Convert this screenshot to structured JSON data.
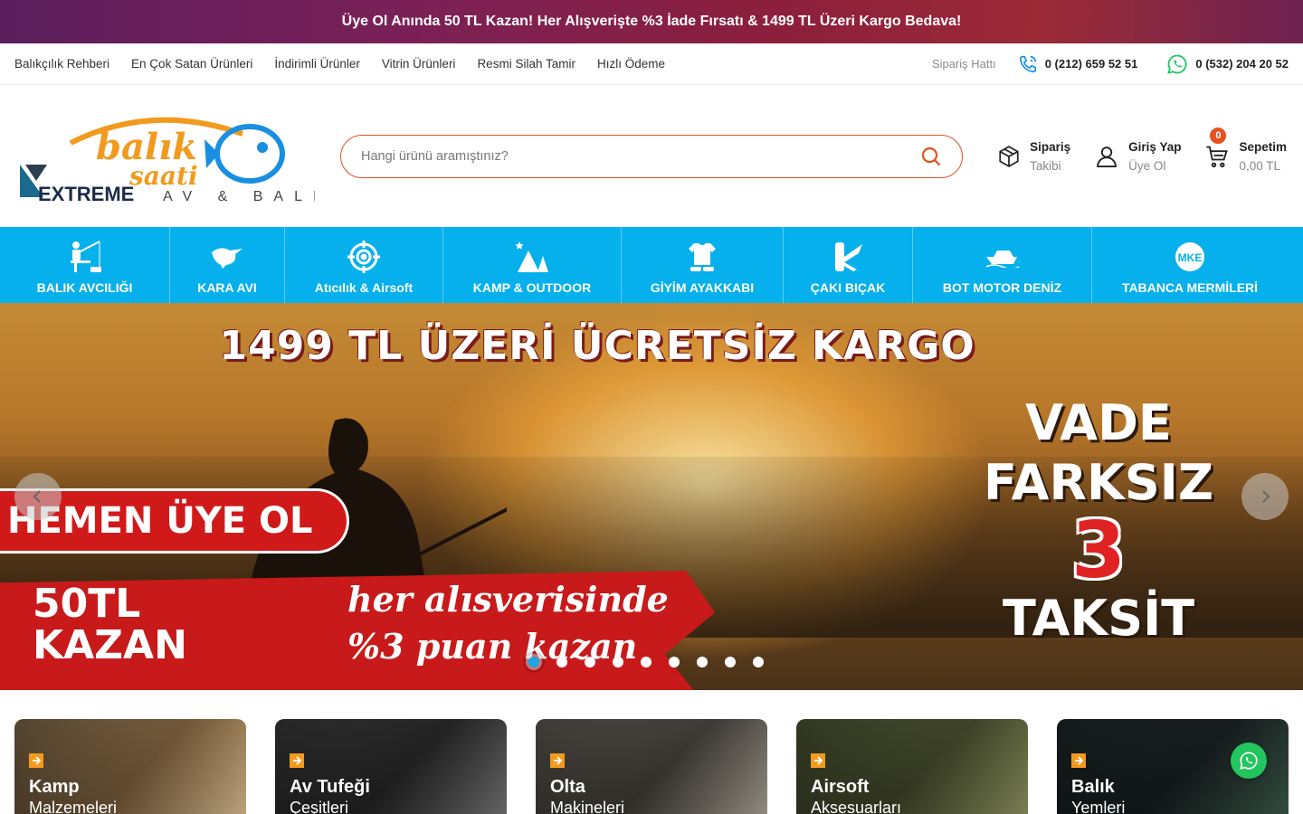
{
  "announcement": "Üye Ol Anında 50 TL Kazan! Her Alışverişte %3 İade Fırsatı & 1499 TL Üzeri Kargo Bedava!",
  "toplinks": [
    "Balıkçılık Rehberi",
    "En Çok Satan Ürünleri",
    "İndirimli Ürünler",
    "Vitrin Ürünleri",
    "Resmi Silah Tamir",
    "Hızlı Ödeme"
  ],
  "contact": {
    "label": "Sipariş Hattı",
    "phone": "0 (212) 659 52 51",
    "whatsapp": "0 (532) 204 20 52"
  },
  "logo": {
    "brand_top": "balık",
    "brand_bottom": "saati",
    "extreme": "EXTREME",
    "tagline": "AV & BALIK"
  },
  "search": {
    "placeholder": "Hangi ürünü aramıştınız?"
  },
  "header_actions": {
    "order": {
      "line1": "Sipariş",
      "line2": "Takibi"
    },
    "account": {
      "line1": "Giriş Yap",
      "line2": "Üye Ol"
    },
    "cart": {
      "line1": "Sepetim",
      "line2": "0,00 TL",
      "count": "0"
    }
  },
  "categories": [
    {
      "label": "BALIK AVCILIĞI",
      "icon": "fisherman-icon"
    },
    {
      "label": "KARA AVI",
      "icon": "bird-icon"
    },
    {
      "label": "Atıcılık & Airsoft",
      "icon": "crosshair-icon"
    },
    {
      "label": "KAMP & OUTDOOR",
      "icon": "tent-icon"
    },
    {
      "label": "GİYİM AYAKKABI",
      "icon": "clothing-icon"
    },
    {
      "label": "ÇAKI BIÇAK",
      "icon": "knife-icon"
    },
    {
      "label": "BOT MOTOR DENİZ",
      "icon": "boat-icon"
    },
    {
      "label": "TABANCA MERMİLERİ",
      "icon": "mke-icon"
    }
  ],
  "hero": {
    "headline": "1499 TL ÜZERİ ÜCRETSİZ KARGO",
    "badge": "HEMEN ÜYE OL",
    "kazan_line1": "50TL",
    "kazan_line2": "KAZAN",
    "puan_line1": "her alısverisinde",
    "puan_line2": "%3 puan kazan",
    "vade_line1": "VADE",
    "vade_line2": "FARKSIZ",
    "vade_line3": "3",
    "vade_line4": "TAKSİT",
    "slide_count": 9,
    "active_slide": 1
  },
  "cards": [
    {
      "title": "Kamp",
      "subtitle": "Malzemeleri"
    },
    {
      "title": "Av Tufeği",
      "subtitle": "Çeşitleri"
    },
    {
      "title": "Olta",
      "subtitle": "Makineleri"
    },
    {
      "title": "Airsoft",
      "subtitle": "Aksesuarları"
    },
    {
      "title": "Balık",
      "subtitle": "Yemleri"
    }
  ],
  "colors": {
    "accent": "#e0531f",
    "nav": "#06b0ec",
    "whatsapp": "#22c55e"
  }
}
